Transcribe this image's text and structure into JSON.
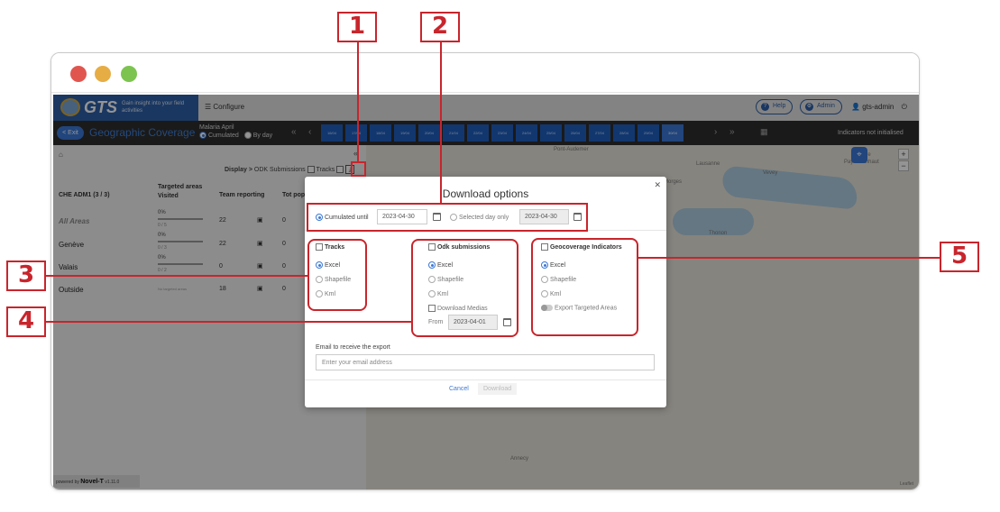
{
  "window": {
    "dots": {
      "close": "#e0564f",
      "minimize": "#e6ad45",
      "maximize": "#7cc44f"
    }
  },
  "header": {
    "brand": "GTS",
    "tagline": "Gain insight into your field activities",
    "configure": "Configure",
    "help": "Help",
    "admin": "Admin",
    "user": "gts-admin"
  },
  "toolbar": {
    "exit": "< Exit",
    "title": "Geographic Coverage",
    "campaign": "Malaria April",
    "mode_cumulated": "Cumulated",
    "mode_byday": "By day",
    "dates": [
      "16/04",
      "17/04",
      "18/04",
      "19/04",
      "20/04",
      "21/04",
      "22/04",
      "23/04",
      "24/04",
      "25/04",
      "26/04",
      "27/04",
      "28/04",
      "29/04",
      "30/04"
    ],
    "active_date": "30/04",
    "status": "Indicators not initialised"
  },
  "left_panel": {
    "display_label": "Display >",
    "odk_label": "ODK Submissions",
    "tracks_label": "Tracks",
    "columns": [
      "CHE ADM1 (3 / 3)",
      "Targeted areas Visited",
      "Team reporting",
      "Tot pop"
    ],
    "rows": [
      {
        "name": "All Areas",
        "pct": "0%",
        "frac": "0 / 5",
        "team": "22",
        "pop": "0"
      },
      {
        "name": "Genève",
        "pct": "0%",
        "frac": "0 / 3",
        "team": "22",
        "pop": "0"
      },
      {
        "name": "Valais",
        "pct": "0%",
        "frac": "0 / 2",
        "team": "0",
        "pop": "0"
      },
      {
        "name": "Outside",
        "pct": "No targeted areas",
        "frac": "",
        "team": "18",
        "pop": "0"
      }
    ],
    "powered": "powered by",
    "powered_brand": "Novel-T",
    "version": "v1.11.0"
  },
  "map": {
    "labels": [
      "Pont-Audemer",
      "Lausanne",
      "Vevey",
      "Morges",
      "Gruyère",
      "Pays-d'Enhaut",
      "Thonon",
      "Annecy",
      "Leaflet"
    ]
  },
  "dialog": {
    "title": "Download options",
    "cumulated_until": "Cumulated until",
    "cumulated_date": "2023-04-30",
    "selected_day": "Selected day only",
    "selected_date": "2023-04-30",
    "tracks": {
      "title": "Tracks",
      "options": [
        "Excel",
        "Shapefile",
        "Kml"
      ]
    },
    "odk": {
      "title": "Odk submissions",
      "options": [
        "Excel",
        "Shapefile",
        "Kml"
      ],
      "medias": "Download Medias",
      "from": "From",
      "from_date": "2023-04-01"
    },
    "geo": {
      "title": "Geocoverage Indicators",
      "options": [
        "Excel",
        "Shapefile",
        "Kml"
      ],
      "export_targeted": "Export Targeted Areas"
    },
    "email_label": "Email to receive the export",
    "email_placeholder": "Enter your email address",
    "cancel": "Cancel",
    "download": "Download"
  },
  "annotations": [
    "1",
    "2",
    "3",
    "4",
    "5"
  ],
  "colors": {
    "annotation_red": "#c8252c",
    "brand_blue": "#2e5fa8",
    "accent_blue": "#3a78d6"
  }
}
